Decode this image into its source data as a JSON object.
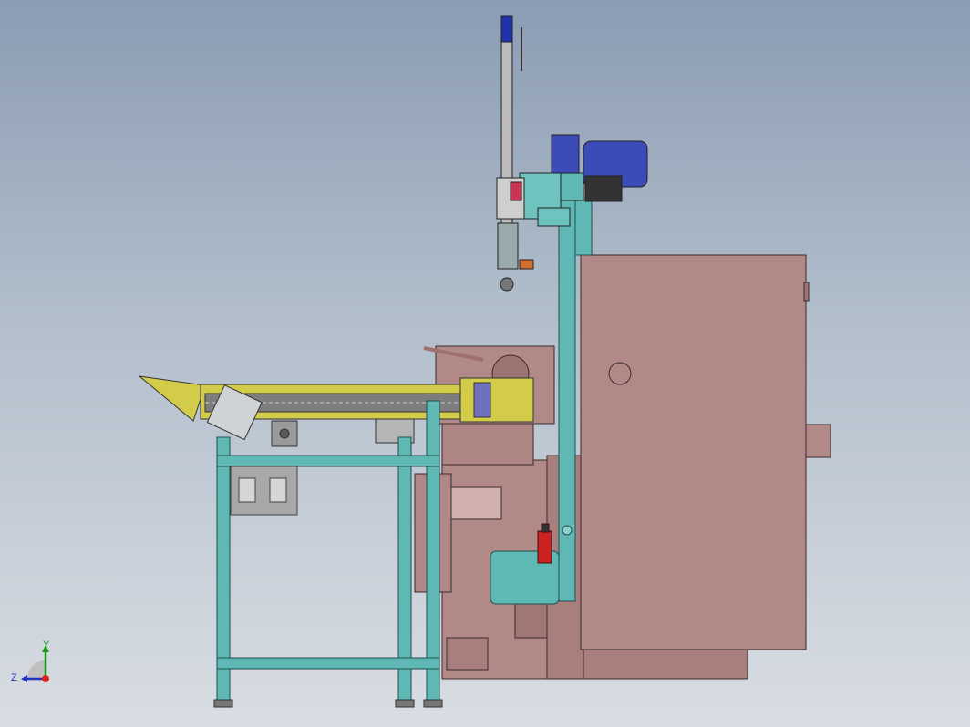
{
  "viewport": {
    "background_top": "#8b9cb3",
    "background_bottom": "#d9dde3"
  },
  "colors": {
    "frame_teal": "#5fb8b4",
    "cabinet_pink": "#b18a88",
    "conveyor_yellow": "#d3cc4a",
    "actuator_blue": "#3b4bb8",
    "regulator_red": "#cc2222",
    "panel_grey": "#a8a8a8"
  },
  "triad": {
    "y_label": "Y",
    "z_label": "Z",
    "icon": "coordinate-triad-icon"
  }
}
